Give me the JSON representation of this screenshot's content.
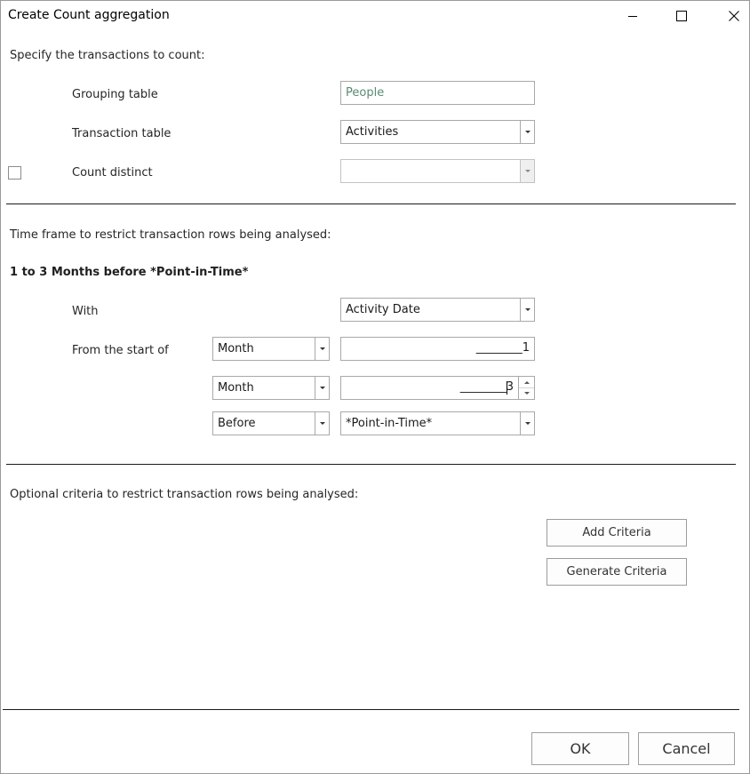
{
  "window": {
    "title": "Create Count aggregation",
    "controls": [
      "minimize-icon",
      "maximize-icon",
      "close-icon"
    ]
  },
  "section_transactions": {
    "heading": "Specify the transactions to count:",
    "grouping_table_label": "Grouping table",
    "grouping_table_value": "People",
    "transaction_table_label": "Transaction table",
    "transaction_table_value": "Activities",
    "count_distinct_label": "Count distinct",
    "count_distinct_checked": false,
    "count_distinct_value": ""
  },
  "section_timeframe": {
    "heading": "Time frame to restrict transaction rows being analysed:",
    "summary": "1 to 3 Months before *Point-in-Time*",
    "with_label": "With",
    "with_value": "Activity Date",
    "from_start_label": "From the start of",
    "unit1_value": "Month",
    "amount1_value": "________1",
    "unit2_value": "Month",
    "amount2_value": "________3",
    "relation_value": "Before",
    "anchor_value": "*Point-in-Time*"
  },
  "section_criteria": {
    "heading": "Optional criteria to restrict transaction rows being analysed:",
    "add_criteria_label": "Add Criteria",
    "generate_criteria_label": "Generate Criteria"
  },
  "footer": {
    "ok_label": "OK",
    "cancel_label": "Cancel"
  },
  "colors": {
    "readonly_text": "#5b8a72",
    "separator": "#1a1a1a",
    "border": "#a9a9a9"
  }
}
